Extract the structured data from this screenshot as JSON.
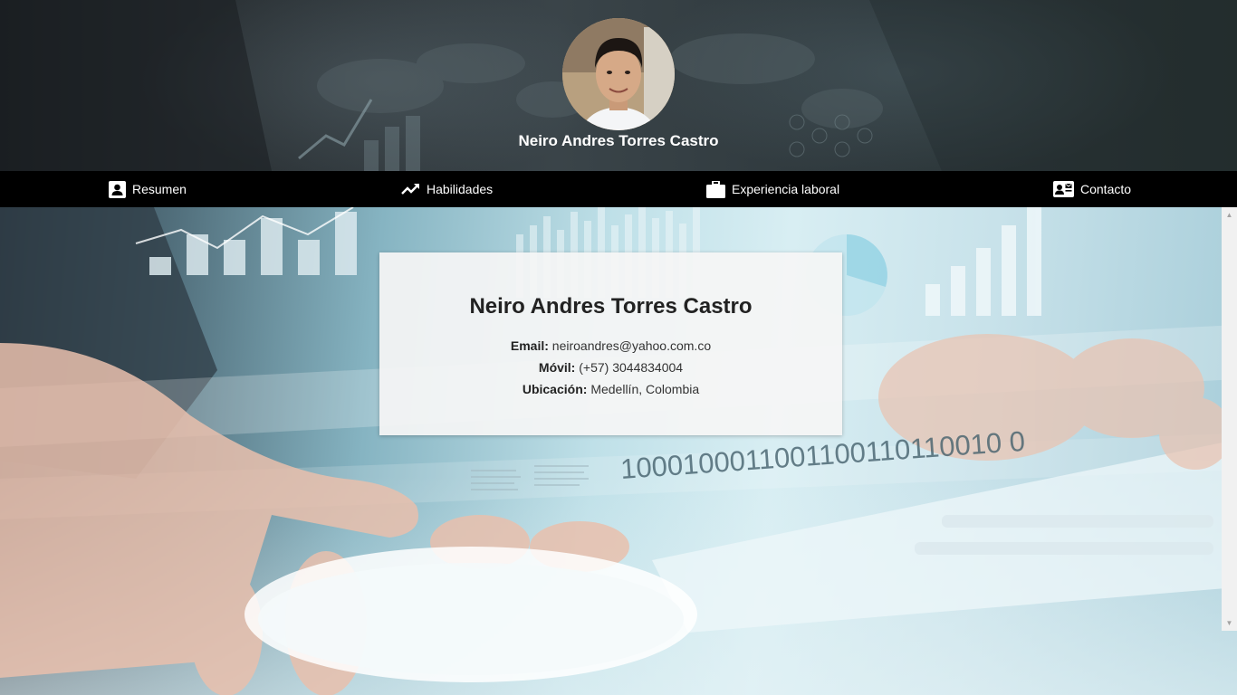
{
  "profile": {
    "name": "Neiro Andres Torres Castro"
  },
  "nav": {
    "items": [
      {
        "label": "Resumen",
        "icon": "person-badge-icon"
      },
      {
        "label": "Habilidades",
        "icon": "trending-up-icon"
      },
      {
        "label": "Experiencia laboral",
        "icon": "briefcase-icon"
      },
      {
        "label": "Contacto",
        "icon": "contact-card-icon"
      }
    ]
  },
  "contact": {
    "title": "Neiro Andres Torres Castro",
    "email_label": "Email:",
    "email_value": "neiroandres@yahoo.com.co",
    "phone_label": "Móvil:",
    "phone_value": "(+57) 3044834004",
    "location_label": "Ubicación:",
    "location_value": "Medellín, Colombia"
  },
  "hero": {
    "binary_text": "1000100011001100110110010 0"
  },
  "colors": {
    "nav_background": "#000000",
    "card_background": "#f5f5f5",
    "text_dark": "#222222"
  }
}
